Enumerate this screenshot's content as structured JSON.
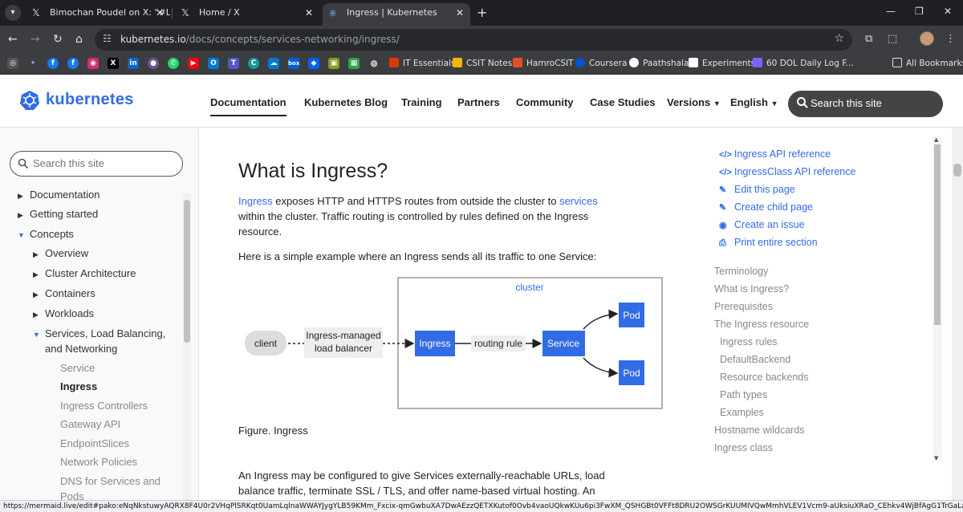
{
  "browser": {
    "tabs": [
      {
        "title": "Bimochan Poudel on X: \"#LSPPU",
        "icon": "x-logo-icon",
        "active": false
      },
      {
        "title": "Home / X",
        "icon": "x-logo-icon",
        "active": false
      },
      {
        "title": "Ingress | Kubernetes",
        "icon": "kubernetes-icon",
        "active": true
      }
    ],
    "url_host": "kubernetes.io",
    "url_path": "/docs/concepts/services-networking/ingress/",
    "bookmarks": [
      {
        "label": "IT Essentials",
        "color": "#d83b01"
      },
      {
        "label": "CSIT Notes",
        "color": "#f4b400"
      },
      {
        "label": "HamroCSIT",
        "color": "#e44d26"
      },
      {
        "label": "Coursera",
        "color": "#0056d2"
      },
      {
        "label": "Paathshala",
        "color": "#ffffff"
      },
      {
        "label": "Experiments",
        "color": "#ffffff"
      },
      {
        "label": "60 DOL Daily Log F...",
        "color": "#7b61ff"
      }
    ],
    "all_bookmarks_label": "All Bookmarks",
    "status_url": "https://mermaid.live/edit#pako:eNqNkstuwyAQRX8F4U0r2VHqPlSRKqt0UamLqlnaWWAYJygYLB59KMm_Fxcix-qmGwbuXA7DwAEzzQETXKutof0Ovb4vaoUQkwKUu6pi3FwXM_QSHGBt0VFFt8DRU2OWSGrKUUMIVQwMmhVLEV1Vcm9-aUksiuXRaO_CEhkv4WjBfAgG1TrGaLa-iaUw6a0Dc..."
  },
  "header": {
    "brand": "kubernetes",
    "nav": [
      "Documentation",
      "Kubernetes Blog",
      "Training",
      "Partners",
      "Community",
      "Case Studies"
    ],
    "versions_label": "Versions",
    "language_label": "English",
    "search_placeholder": "Search this site"
  },
  "sidebar": {
    "search_placeholder": "Search this site",
    "items": [
      "Documentation",
      "Getting started",
      "Concepts"
    ],
    "concept_items": [
      "Overview",
      "Cluster Architecture",
      "Containers",
      "Workloads"
    ],
    "open_section": [
      "Services, Load Balancing,",
      "and Networking"
    ],
    "sub_items": [
      "Service",
      "Ingress",
      "Ingress Controllers",
      "Gateway API",
      "EndpointSlices",
      "Network Policies",
      "DNS for Services and",
      "Pods"
    ]
  },
  "article": {
    "heading": "What is Ingress?",
    "p1_link1": "Ingress",
    "p1_text1": " exposes HTTP and HTTPS routes from outside the cluster to ",
    "p1_link2": "services",
    "p1_text2": " within the cluster. Traffic routing is controlled by rules defined on the Ingress resource.",
    "p2": "Here is a simple example where an Ingress sends all its traffic to one Service:",
    "figure": {
      "cluster_label": "cluster",
      "client": "client",
      "lb_line1": "Ingress-managed",
      "lb_line2": "load balancer",
      "ingress": "Ingress",
      "rule": "routing rule",
      "service": "Service",
      "pod1": "Pod",
      "pod2": "Pod"
    },
    "caption": "Figure. Ingress",
    "p3": "An Ingress may be configured to give Services externally-reachable URLs, load balance traffic, terminate SSL / TLS, and offer name-based virtual hosting. An"
  },
  "toc": {
    "links": [
      {
        "label": "Ingress API reference",
        "icon": "code-icon"
      },
      {
        "label": "IngressClass API reference",
        "icon": "code-icon"
      },
      {
        "label": "Edit this page",
        "icon": "edit-icon"
      },
      {
        "label": "Create child page",
        "icon": "edit-icon"
      },
      {
        "label": "Create an issue",
        "icon": "github-icon"
      },
      {
        "label": "Print entire section",
        "icon": "print-icon"
      }
    ],
    "items": [
      {
        "label": "Terminology",
        "indent": 0
      },
      {
        "label": "What is Ingress?",
        "indent": 0
      },
      {
        "label": "Prerequisites",
        "indent": 0
      },
      {
        "label": "The Ingress resource",
        "indent": 0
      },
      {
        "label": "Ingress rules",
        "indent": 1
      },
      {
        "label": "DefaultBackend",
        "indent": 1
      },
      {
        "label": "Resource backends",
        "indent": 1
      },
      {
        "label": "Path types",
        "indent": 1
      },
      {
        "label": "Examples",
        "indent": 1
      },
      {
        "label": "Hostname wildcards",
        "indent": 0
      },
      {
        "label": "Ingress class",
        "indent": 0
      }
    ]
  },
  "colors": {
    "accent": "#326ce5",
    "chrome_dark": "#3c3d41"
  }
}
